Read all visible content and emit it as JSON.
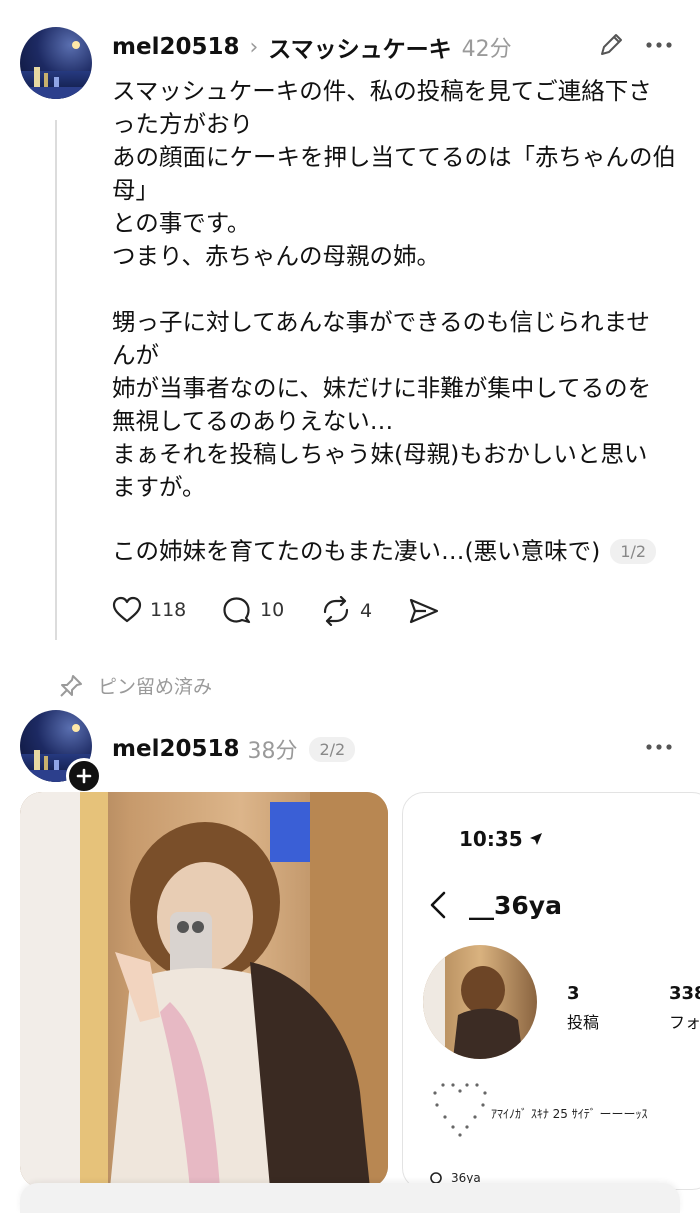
{
  "post1": {
    "username": "mel20518",
    "breadcrumb_sep": "›",
    "topic": "スマッシュケーキ",
    "time": "42分",
    "paragraph1": "スマッシュケーキの件、私の投稿を見てご連絡下さ\nった方がおり\nあの顔面にケーキを押し当ててるのは「赤ちゃんの伯\n母」\nとの事です。\nつまり、赤ちゃんの母親の姉。",
    "paragraph2": "甥っ子に対してあんな事ができるのも信じられませ\nんが\n姉が当事者なのに、妹だけに非難が集中してるのを\n無視してるのありえない…\nまぁそれを投稿しちゃう妹(母親)もおかしいと思い\nますが。",
    "paragraph3": "この姉妹を育てたのもまた凄い…(悪い意味で)",
    "counter": "1/2",
    "likes": "118",
    "replies": "10",
    "reposts": "4"
  },
  "pinned_label": "ピン留め済み",
  "post2": {
    "username": "mel20518",
    "time": "38分",
    "counter": "2/2"
  },
  "screenshot2": {
    "clock": "10:35",
    "profile_name": "__36ya",
    "posts_count": "3",
    "posts_label": "投稿",
    "followers_count": "338",
    "followers_label": "フォ",
    "bio": "ｱﾏｲﾉｶﾞ ｽｷﾅ 25 ｻｲﾃﾞ ーーーｯｽ",
    "threads_handle": "36ya"
  }
}
